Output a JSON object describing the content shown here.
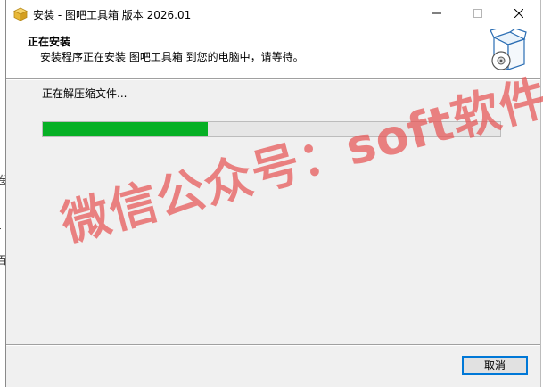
{
  "window": {
    "title": "安装 - 图吧工具箱 版本 2026.01"
  },
  "titlebar_buttons": {
    "minimize_icon": "minimize-icon",
    "maximize_icon": "maximize-icon",
    "close_icon": "close-icon"
  },
  "header": {
    "title": "正在安装",
    "subtitle": "安装程序正在安装 图吧工具箱 到您的电脑中，请等待。",
    "image_icon": "install-box-disc-icon"
  },
  "main": {
    "status_text": "正在解压缩文件...",
    "progress_fraction": 0.36
  },
  "watermark": {
    "text": "微信公众号：soft软件"
  },
  "footer": {
    "cancel_label": "取消"
  },
  "colors": {
    "progress_fill": "#06b025",
    "progress_track": "#e6e6e6",
    "accent": "#0078d7",
    "watermark": "#e65555"
  }
}
